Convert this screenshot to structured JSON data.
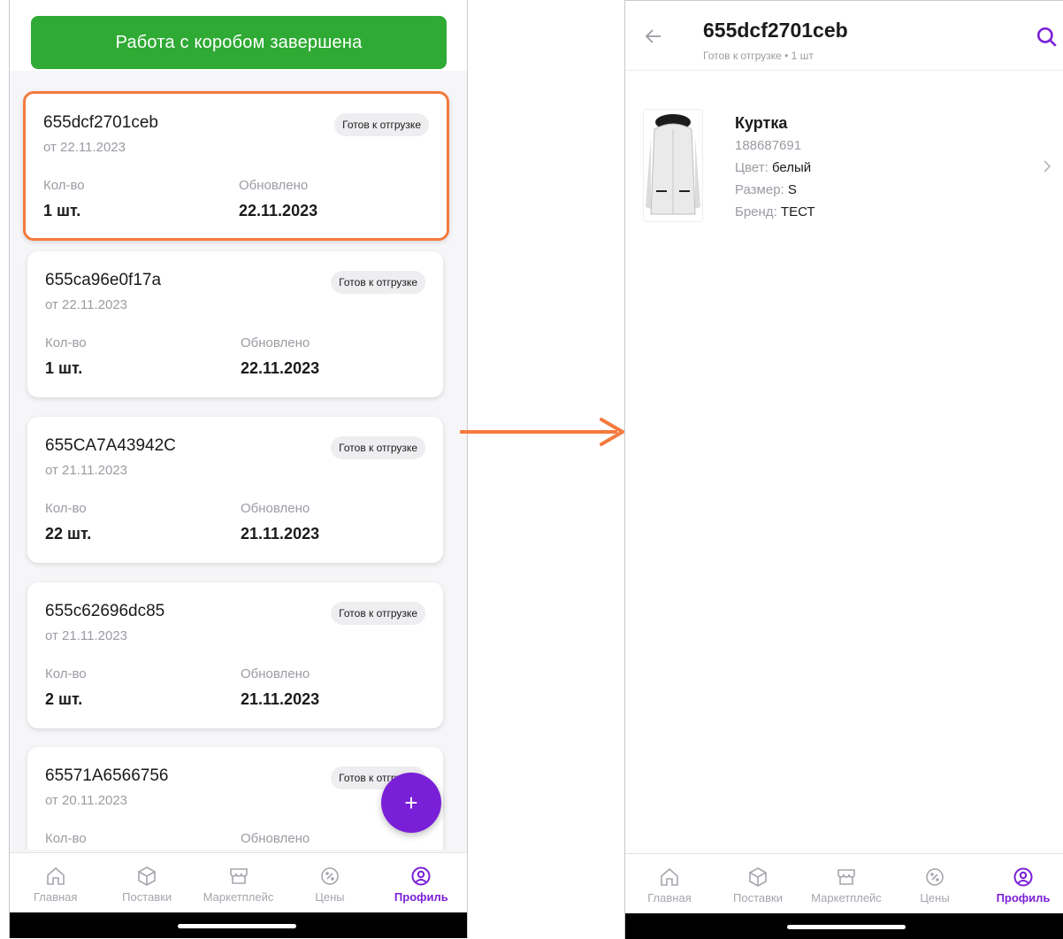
{
  "left_screen": {
    "done_button_label": "Работа с коробом завершена",
    "qty_label": "Кол-во",
    "updated_label": "Обновлено",
    "boxes": [
      {
        "id": "655dcf2701ceb",
        "date": "от 22.11.2023",
        "status": "Готов к отгрузке",
        "qty": "1 шт.",
        "updated": "22.11.2023"
      },
      {
        "id": "655ca96e0f17a",
        "date": "от 22.11.2023",
        "status": "Готов к отгрузке",
        "qty": "1 шт.",
        "updated": "22.11.2023"
      },
      {
        "id": "655CA7A43942C",
        "date": "от 21.11.2023",
        "status": "Готов к отгрузке",
        "qty": "22 шт.",
        "updated": "21.11.2023"
      },
      {
        "id": "655c62696dc85",
        "date": "от 21.11.2023",
        "status": "Готов к отгрузке",
        "qty": "2 шт.",
        "updated": "21.11.2023"
      },
      {
        "id": "65571A6566756",
        "date": "от 20.11.2023",
        "status": "Готов к отгрузке",
        "qty": "",
        "updated": ""
      }
    ],
    "fab_label": "+",
    "highlight_color": "#f47a3e"
  },
  "right_screen": {
    "title": "655dcf2701ceb",
    "subtitle": "Готов к отгрузке • 1 шт",
    "product": {
      "name": "Куртка",
      "article": "188687691",
      "color_label": "Цвет:",
      "color_value": "белый",
      "size_label": "Размер:",
      "size_value": "S",
      "brand_label": "Бренд:",
      "brand_value": "ТЕСТ"
    }
  },
  "tabbar": {
    "tabs": [
      {
        "label": "Главная",
        "icon": "home-icon"
      },
      {
        "label": "Поставки",
        "icon": "box-icon"
      },
      {
        "label": "Маркетплейс",
        "icon": "store-icon"
      },
      {
        "label": "Цены",
        "icon": "discount-icon"
      },
      {
        "label": "Профиль",
        "icon": "profile-icon"
      }
    ],
    "active_index": 4
  },
  "colors": {
    "accent": "#7a1fd8",
    "success": "#2faa34",
    "arrow": "#f47a3e"
  }
}
